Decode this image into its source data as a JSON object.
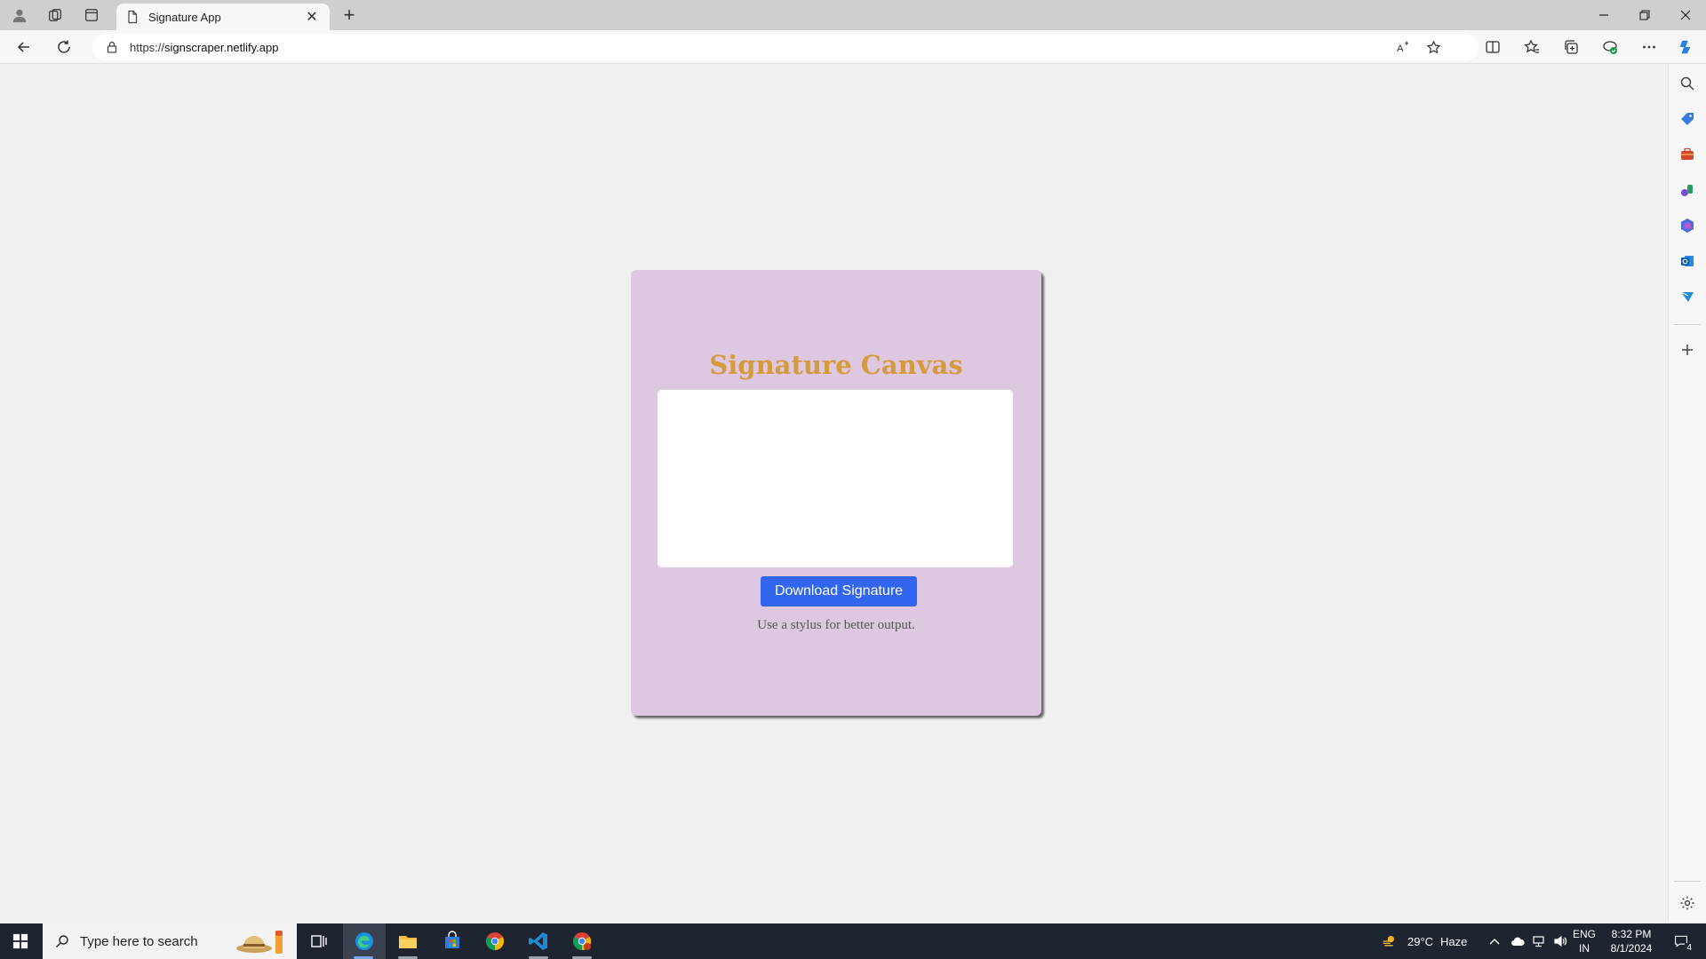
{
  "browser": {
    "tab_title": "Signature App",
    "url_prefix": "https://",
    "url_domain": "signscraper.netlify.app"
  },
  "page": {
    "title": "Signature Canvas",
    "download_button": "Download Signature",
    "hint": "Use a stylus for better output.",
    "colors": {
      "card_bg": "#dec7e0",
      "title": "#d49a3c",
      "button": "#3366f0"
    }
  },
  "taskbar": {
    "search_placeholder": "Type here to search",
    "weather_temp": "29°C",
    "weather_desc": "Haze",
    "lang_top": "ENG",
    "lang_bottom": "IN",
    "time": "8:32 PM",
    "date": "8/1/2024",
    "notification_count": "4"
  }
}
